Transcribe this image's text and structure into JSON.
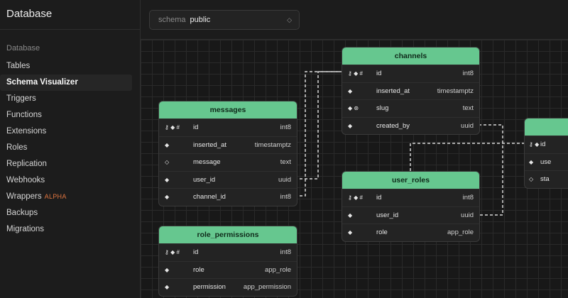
{
  "sidebar": {
    "title": "Database",
    "section": "Database",
    "items": [
      {
        "label": "Tables"
      },
      {
        "label": "Schema Visualizer",
        "active": true
      },
      {
        "label": "Triggers"
      },
      {
        "label": "Functions"
      },
      {
        "label": "Extensions"
      },
      {
        "label": "Roles"
      },
      {
        "label": "Replication"
      },
      {
        "label": "Webhooks"
      },
      {
        "label": "Wrappers",
        "badge": "ALPHA"
      },
      {
        "label": "Backups"
      },
      {
        "label": "Migrations"
      }
    ]
  },
  "schema_selector": {
    "label": "schema",
    "value": "public"
  },
  "tables": {
    "channels": {
      "name": "channels",
      "columns": [
        {
          "name": "id",
          "type": "int8",
          "icons": "⚷ ◆ #"
        },
        {
          "name": "inserted_at",
          "type": "timestamptz",
          "icons": "◆"
        },
        {
          "name": "slug",
          "type": "text",
          "icons": "◆ ⊛"
        },
        {
          "name": "created_by",
          "type": "uuid",
          "icons": "◆"
        }
      ]
    },
    "messages": {
      "name": "messages",
      "columns": [
        {
          "name": "id",
          "type": "int8",
          "icons": "⚷ ◆ #"
        },
        {
          "name": "inserted_at",
          "type": "timestamptz",
          "icons": "◆"
        },
        {
          "name": "message",
          "type": "text",
          "icons": "◇"
        },
        {
          "name": "user_id",
          "type": "uuid",
          "icons": "◆"
        },
        {
          "name": "channel_id",
          "type": "int8",
          "icons": "◆"
        }
      ]
    },
    "user_roles": {
      "name": "user_roles",
      "columns": [
        {
          "name": "id",
          "type": "int8",
          "icons": "⚷ ◆ #"
        },
        {
          "name": "user_id",
          "type": "uuid",
          "icons": "◆"
        },
        {
          "name": "role",
          "type": "app_role",
          "icons": "◆"
        }
      ]
    },
    "role_permissions": {
      "name": "role_permissions",
      "columns": [
        {
          "name": "id",
          "type": "int8",
          "icons": "⚷ ◆ #"
        },
        {
          "name": "role",
          "type": "app_role",
          "icons": "◆"
        },
        {
          "name": "permission",
          "type": "app_permission",
          "icons": "◆"
        }
      ]
    },
    "partial": {
      "columns": [
        {
          "name": "id",
          "icons": "⚷ ◆"
        },
        {
          "name": "use",
          "icons": "◆"
        },
        {
          "name": "sta",
          "icons": "◇"
        }
      ]
    }
  },
  "colors": {
    "header_green": "#66c78f",
    "badge_orange": "#e0753f"
  }
}
